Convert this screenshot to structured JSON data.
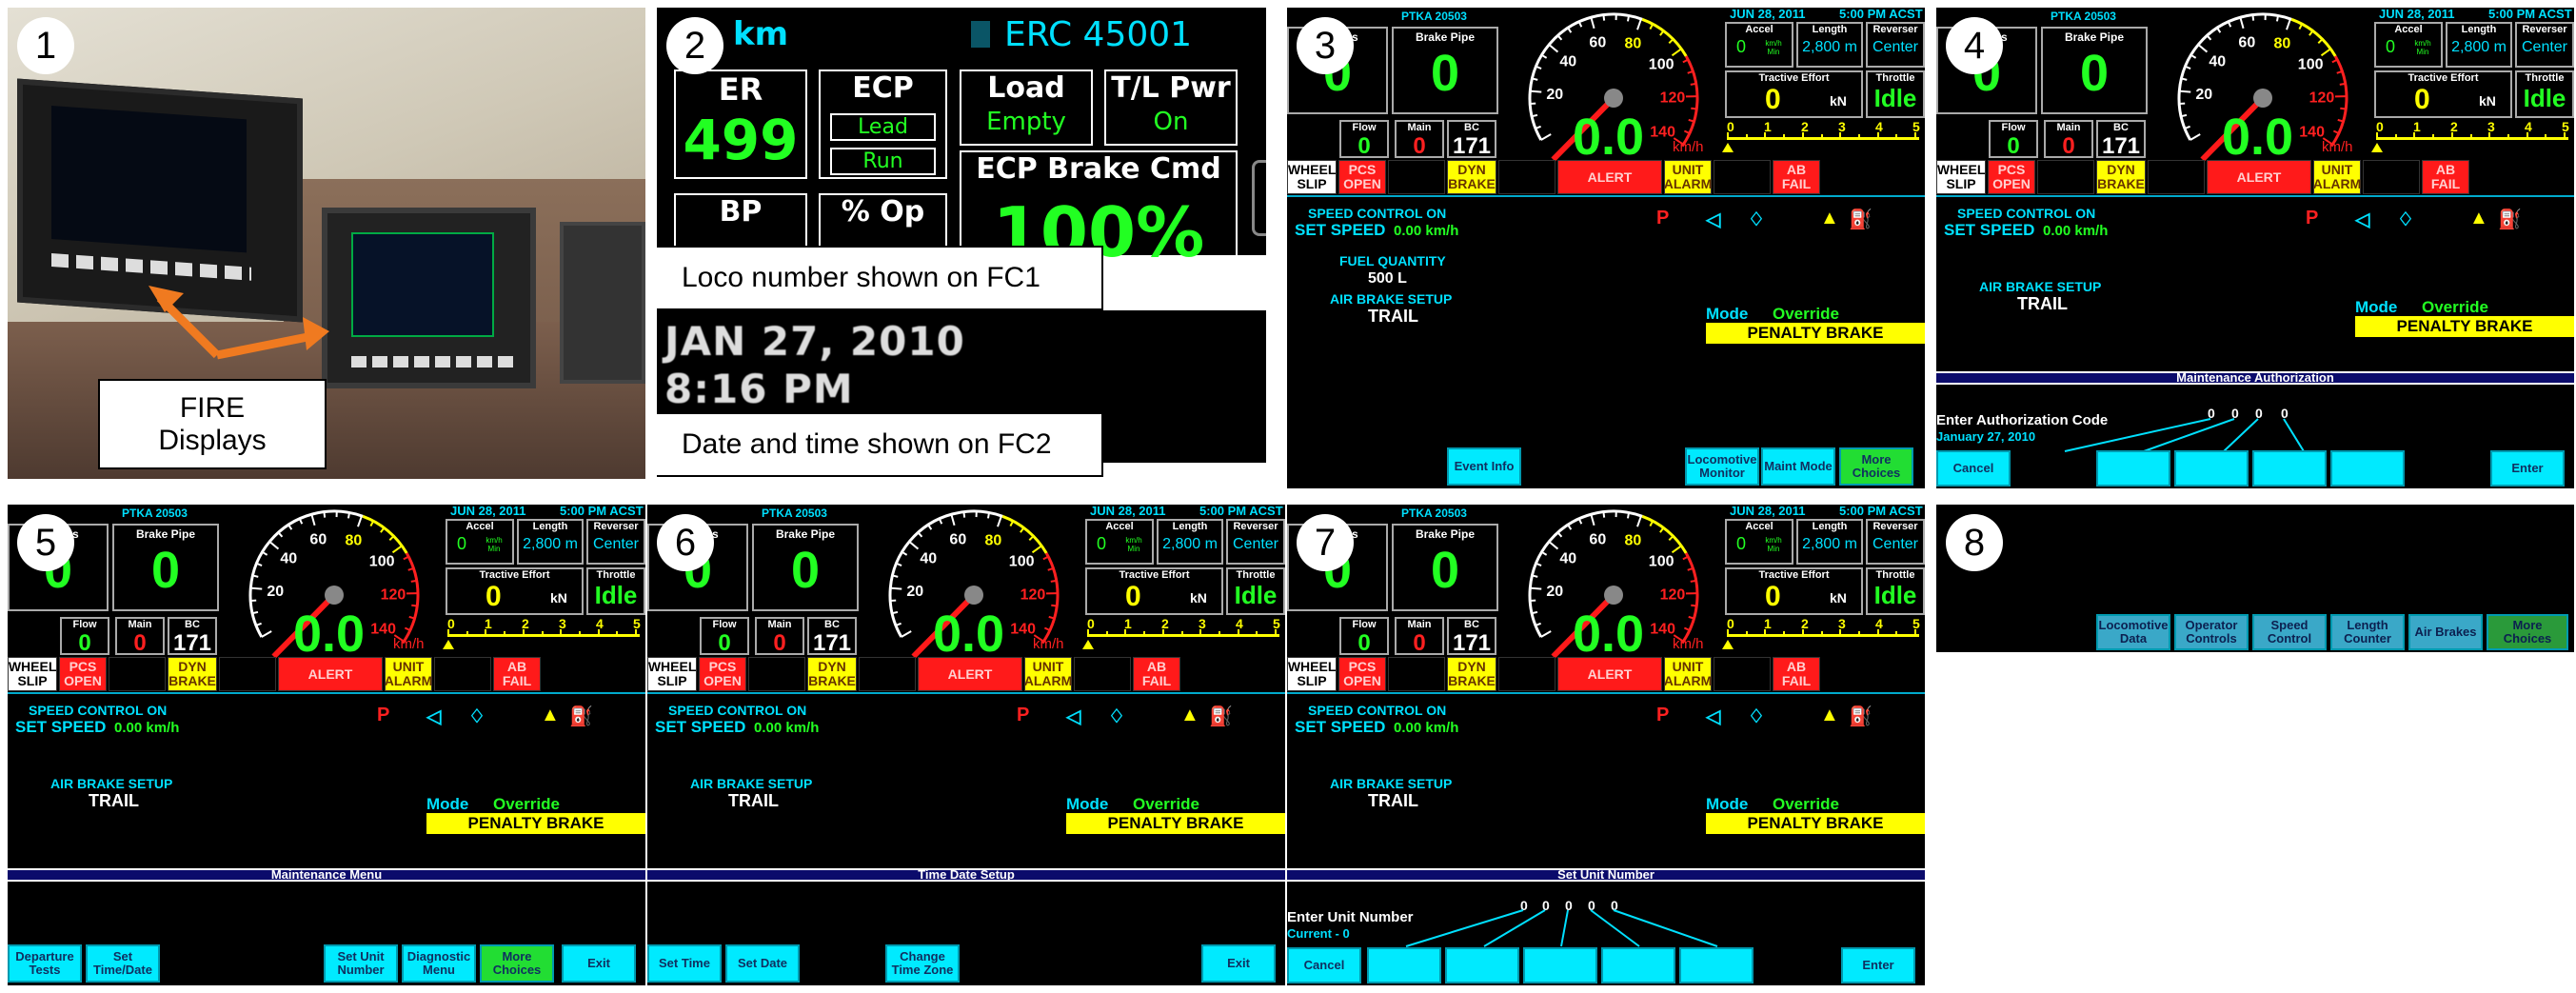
{
  "panels": [
    "1",
    "2",
    "3",
    "4",
    "5",
    "6",
    "7",
    "8"
  ],
  "p1": {
    "label_line1": "FIRE",
    "label_line2": "Displays"
  },
  "p2": {
    "km": "km",
    "loco": "ERC 45001",
    "er_label": "ER",
    "er_value": "499",
    "ecp_label": "ECP",
    "ecp_lead": "Lead",
    "ecp_run": "Run",
    "load_label": "Load",
    "load_value": "Empty",
    "tlpwr_label": "T/L Pwr",
    "tlpwr_value": "On",
    "bp_label": "BP",
    "op_label": "% Op",
    "ecp_cmd_label": "ECP Brake Cmd",
    "ecp_cmd_value": "100%",
    "callout1": "Loco number shown on FC1",
    "date": "JAN 27, 2010",
    "time": "8:16 PM",
    "callout2": "Date and time shown on FC2"
  },
  "dash": {
    "loco_top": "PTKA 20503",
    "eq_res": "ing Res",
    "brake_pipe": "Brake Pipe",
    "eq_res_value": "0",
    "brake_pipe_value": "0",
    "flow_label": "Flow",
    "flow_value": "0",
    "main_label": "Main",
    "main_value": "0",
    "bc_label": "BC",
    "bc_value": "171",
    "date": "JUN 28, 2011",
    "time": "5:00 PM ACST",
    "accel_label": "Accel",
    "accel_value": "0",
    "accel_unit": "km/h Min",
    "length_label": "Length",
    "length_value": "2,800 m",
    "reverser_label": "Reverser",
    "reverser_value": "Center",
    "te_label": "Tractive Effort",
    "te_value": "0",
    "te_unit": "kN",
    "throttle_label": "Throttle",
    "throttle_value": "Idle",
    "speed": "0.0",
    "speed_unit": "km/h",
    "gauge_ticks": [
      "20",
      "40",
      "60",
      "80",
      "100",
      "120",
      "140"
    ],
    "scale": [
      "0",
      "1",
      "2",
      "3",
      "4",
      "5"
    ],
    "wheel_slip": "WHEEL SLIP",
    "pcs_open": "PCS OPEN",
    "dyn_brake": "DYN BRAKE",
    "alert": "ALERT",
    "unit_alarm": "UNIT ALARM",
    "ab_fail": "AB FAIL",
    "speed_control": "SPEED CONTROL ON",
    "set_speed": "SET SPEED",
    "set_speed_value": "0.00 km/h",
    "fuel_label": "FUEL QUANTITY",
    "fuel_value": "500 L",
    "airbrake_label": "AIR BRAKE SETUP",
    "airbrake_value": "TRAIL",
    "mode_label": "Mode",
    "mode_value": "Override",
    "penalty": "PENALTY BRAKE"
  },
  "p3": {
    "buttons": [
      "Event Info",
      "Locomotive Monitor",
      "Maint Mode",
      "More Choices"
    ]
  },
  "p4": {
    "bar": "Maintenance Authorization",
    "prompt": "Enter Authorization Code",
    "date": "January 27, 2010",
    "digits": [
      "0",
      "0",
      "0",
      "0"
    ],
    "cancel": "Cancel",
    "enter": "Enter"
  },
  "p5": {
    "bar": "Maintenance Menu",
    "buttons": [
      "Departure Tests",
      "Set Time/Date",
      "Set Unit Number",
      "Diagnostic Menu",
      "More Choices",
      "Exit"
    ]
  },
  "p6": {
    "bar": "Time Date Setup",
    "buttons": [
      "Set Time",
      "Set Date",
      "Change Time Zone",
      "Exit"
    ]
  },
  "p7": {
    "bar": "Set Unit Number",
    "prompt": "Enter Unit Number",
    "current": "Current - 0",
    "digits": [
      "0",
      "0",
      "0",
      "0",
      "0"
    ],
    "cancel": "Cancel",
    "enter": "Enter"
  },
  "p8": {
    "buttons": [
      "Locomotive Data",
      "Operator Controls",
      "Speed Control",
      "Length Counter",
      "Air Brakes",
      "More Choices"
    ]
  },
  "colors": {
    "cyan": "#00e0ff",
    "green": "#22ff22",
    "yellow": "#ffff00",
    "red": "#ff2020",
    "navy": "#0b0b6b"
  }
}
